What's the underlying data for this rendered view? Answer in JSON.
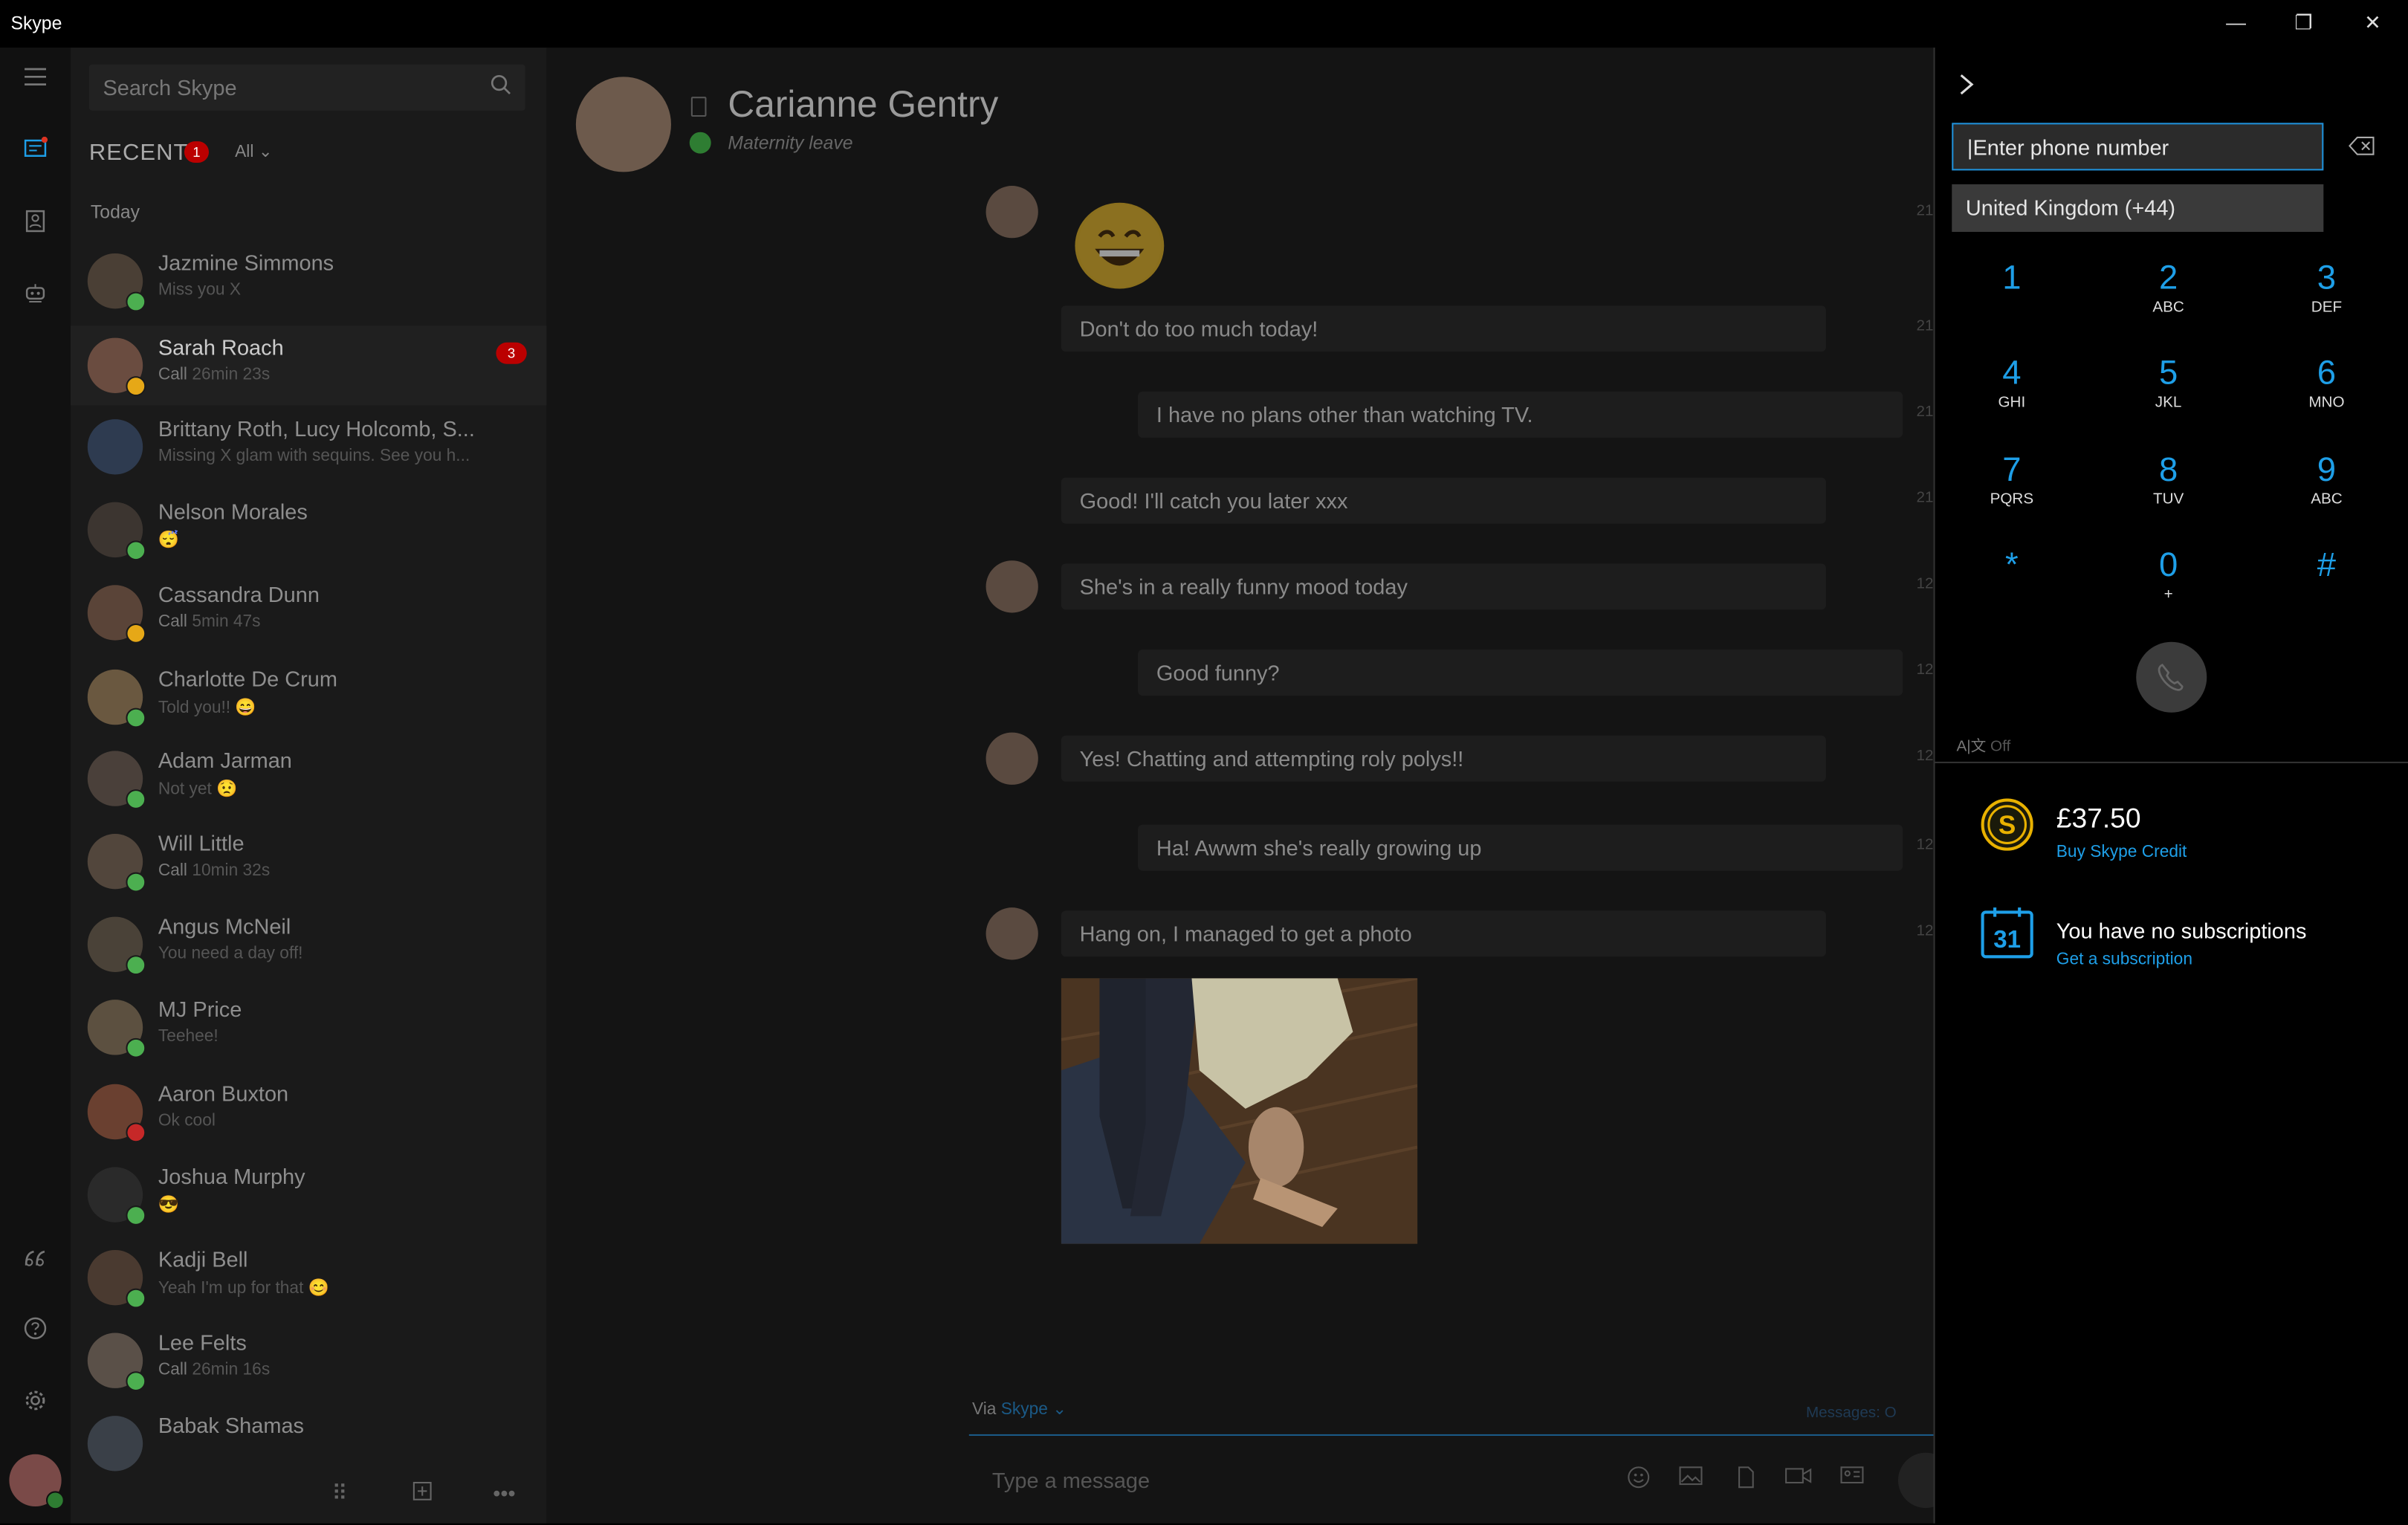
{
  "app": {
    "title": "Skype"
  },
  "window": {
    "minimize": "—",
    "restore": "❐",
    "close": "✕"
  },
  "search": {
    "placeholder": "Search Skype"
  },
  "recent": {
    "label": "RECENT",
    "badge": "1",
    "filter": "All ⌄"
  },
  "section": "Today",
  "contacts": [
    {
      "name": "Jazmine Simmons",
      "sub": "Miss you X",
      "presence": "#4caf50"
    },
    {
      "name": "Sarah Roach",
      "sub_bold": "Call",
      "sub": "26min 23s",
      "badge": "3",
      "presence": "#e6a817",
      "selected": true
    },
    {
      "name": "Brittany Roth, Lucy Holcomb, S...",
      "sub": "Missing X glam with sequins. See you h...",
      "presence": ""
    },
    {
      "name": "Nelson Morales",
      "sub": "😴",
      "presence": "#4caf50"
    },
    {
      "name": "Cassandra Dunn",
      "sub_bold": "Call",
      "sub": "5min 47s",
      "presence": "#e6a817"
    },
    {
      "name": "Charlotte De Crum",
      "sub": "Told you!! 😄",
      "presence": "#4caf50"
    },
    {
      "name": "Adam Jarman",
      "sub": "Not yet 😟",
      "presence": "#4caf50"
    },
    {
      "name": "Will Little",
      "sub_bold": "Call",
      "sub": "10min 32s",
      "presence": "#4caf50"
    },
    {
      "name": "Angus McNeil",
      "sub": "You need a day off!",
      "presence": "#4caf50"
    },
    {
      "name": "MJ Price",
      "sub": "Teehee!",
      "presence": "#4caf50"
    },
    {
      "name": "Aaron Buxton",
      "sub": "Ok cool",
      "presence": "#c62828"
    },
    {
      "name": "Joshua Murphy",
      "sub": "😎",
      "presence": "#4caf50"
    },
    {
      "name": "Kadji Bell",
      "sub": "Yeah I'm up for that 😊",
      "presence": "#4caf50"
    },
    {
      "name": "Lee Felts",
      "sub_bold": "Call",
      "sub": "26min 16s",
      "presence": "#4caf50"
    },
    {
      "name": "Babak Shamas",
      "sub": "",
      "presence": ""
    }
  ],
  "chat": {
    "name": "Carianne Gentry",
    "status": "Maternity leave",
    "messages": [
      {
        "text": "Don't do too much today!",
        "dir": "in",
        "ts": "21"
      },
      {
        "text": "I have no plans other than watching TV.",
        "dir": "out",
        "ts": "21"
      },
      {
        "text": "Good! I'll catch you later xxx",
        "dir": "in",
        "ts": "21"
      },
      {
        "text": "She's in a really funny mood today",
        "dir": "in",
        "ts": "12",
        "avatar": true
      },
      {
        "text": "Good funny?",
        "dir": "out",
        "ts": "12"
      },
      {
        "text": "Yes! Chatting and attempting roly polys!!",
        "dir": "in",
        "ts": "12",
        "avatar": true
      },
      {
        "text": "Ha! Awwm she's really growing up",
        "dir": "out",
        "ts": "12"
      },
      {
        "text": "Hang on, I managed to get a photo",
        "dir": "in",
        "ts": "12",
        "avatar": true
      }
    ],
    "emoji_ts": "21",
    "via_label": "Via",
    "via_service": "Skype ⌄",
    "messages_note": "Messages: O",
    "composer_placeholder": "Type a message"
  },
  "dialpad": {
    "input_placeholder": "|Enter phone number",
    "country": "United Kingdom (+44)",
    "keys": [
      {
        "d": "1",
        "l": ""
      },
      {
        "d": "2",
        "l": "ABC"
      },
      {
        "d": "3",
        "l": "DEF"
      },
      {
        "d": "4",
        "l": "GHI"
      },
      {
        "d": "5",
        "l": "JKL"
      },
      {
        "d": "6",
        "l": "MNO"
      },
      {
        "d": "7",
        "l": "PQRS"
      },
      {
        "d": "8",
        "l": "TUV"
      },
      {
        "d": "9",
        "l": "ABC"
      },
      {
        "d": "*",
        "l": ""
      },
      {
        "d": "0",
        "l": "+"
      },
      {
        "d": "#",
        "l": ""
      }
    ],
    "translator": "Off",
    "credit_amount": "£37.50",
    "credit_link": "Buy Skype Credit",
    "sub_calendar": "31",
    "sub_text": "You have no subscriptions",
    "sub_link": "Get a subscription"
  }
}
